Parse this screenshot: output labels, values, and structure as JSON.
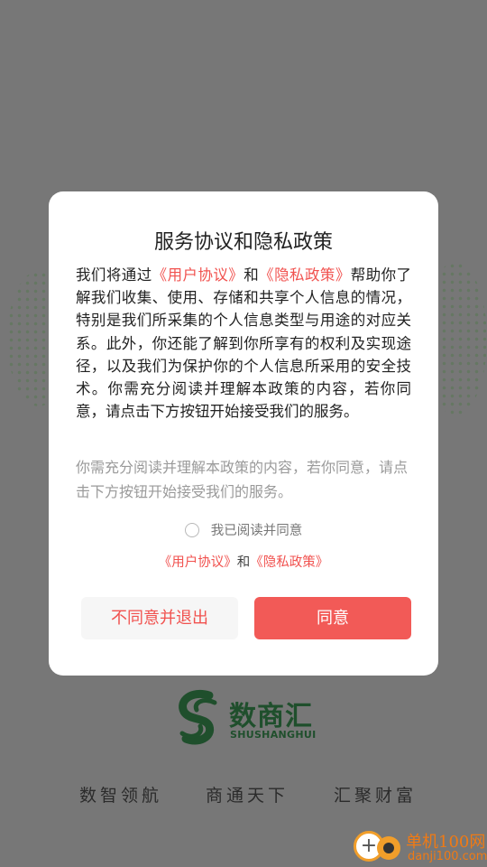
{
  "splash": {
    "logo_cn": "数商汇",
    "logo_en": "SHUSHANGHUI",
    "slogans": [
      "数智领航",
      "商通天下",
      "汇聚财富"
    ]
  },
  "watermark": {
    "title": "单机100网",
    "url": "danji100.com"
  },
  "dialog": {
    "title": "服务协议和隐私政策",
    "body": {
      "intro": "我们将通过",
      "user_agreement": "《用户协议》",
      "and": "和",
      "privacy_policy": "《隐私政策》",
      "rest": "帮助你了解我们收集、使用、存储和共享个人信息的情况，特别是我们所采集的个人信息类型与用途的对应关系。此外，你还能了解到你所享有的权利及实现途径，以及我们为保护你的个人信息所采用的安全技术。你需充分阅读并理解本政策的内容，若你同意，请点击下方按钮开始接受我们的服务。"
    },
    "hint": "你需充分阅读并理解本政策的内容，若你同意，请点击下方按钮开始接受我们的服务。",
    "agree_checkbox_label": "我已阅读并同意",
    "links": {
      "user_agreement": "《用户协议》",
      "and": "和",
      "privacy_policy": "《隐私政策》"
    },
    "buttons": {
      "disagree": "不同意并退出",
      "agree": "同意"
    }
  },
  "colors": {
    "accent": "#f25a57",
    "link": "#f1524f",
    "overlay": "#777777",
    "brand_green": "#1f4f2c"
  }
}
